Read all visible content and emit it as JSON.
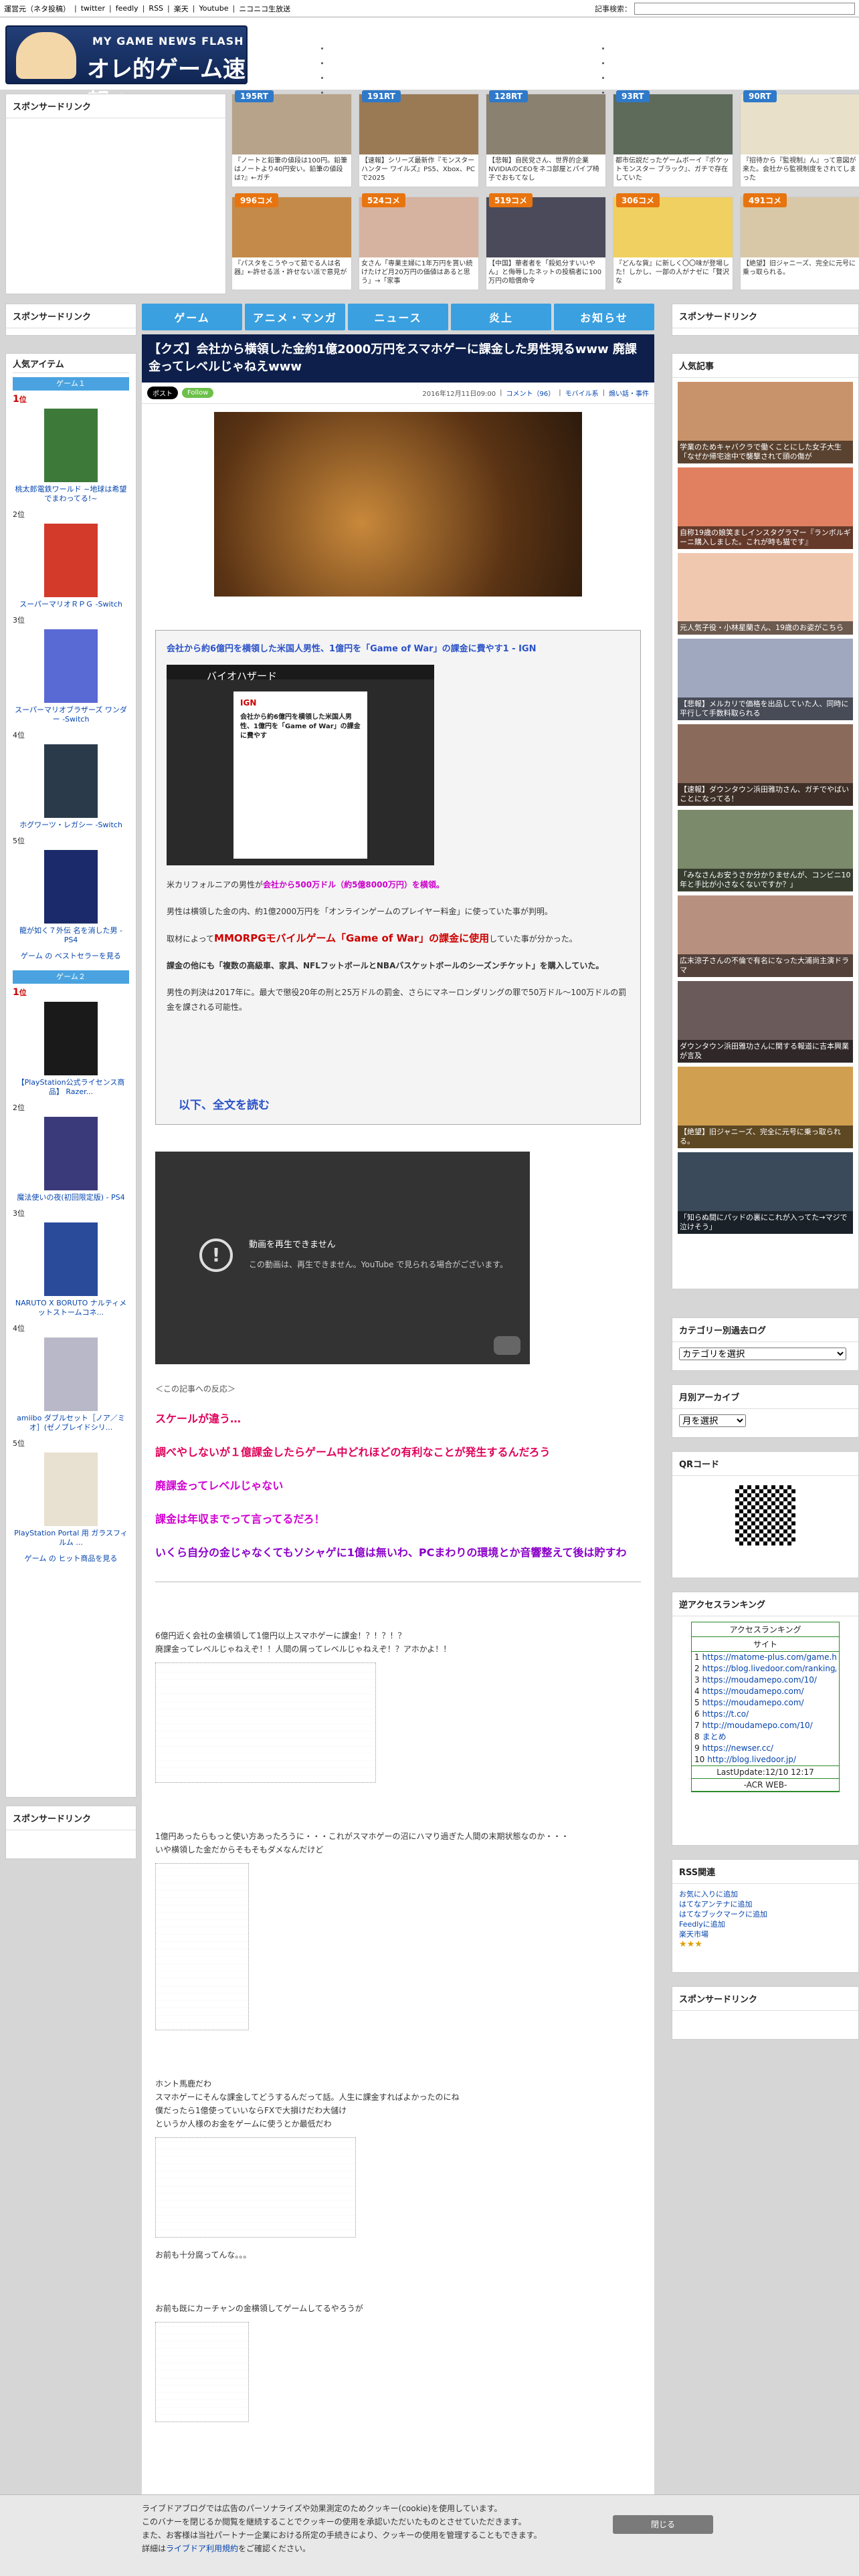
{
  "topbar": {
    "links": [
      "運営元（ネタ投稿）",
      "twitter",
      "feedly",
      "RSS",
      "楽天",
      "Youtube",
      "ニコニコ生放送"
    ],
    "search_label": "記事検索："
  },
  "logo": {
    "en": "MY GAME NEWS FLASH",
    "ja": "オレ的ゲーム速報@JIN"
  },
  "sponsored": "スポンサードリンク",
  "thumbs": [
    {
      "badge": "195RT",
      "color": "#2f79c9",
      "caption": "『ノートと鉛筆の値段は100円。鉛筆はノートより40円安い。鉛筆の値段は?』←ガチ"
    },
    {
      "badge": "191RT",
      "color": "#2f79c9",
      "caption": "【速報】シリーズ最新作『モンスターハンター ワイルズ』PS5、Xbox、PCで2025"
    },
    {
      "badge": "128RT",
      "color": "#2f79c9",
      "caption": "【悲報】自民党さん、世界的企業NVIDIAのCEOをネコ部屋とパイプ椅子でおもてなし"
    },
    {
      "badge": "93RT",
      "color": "#2f79c9",
      "caption": "都市伝説だったゲームボーイ『ポケットモンスター ブラック』、ガチで存在していた"
    },
    {
      "badge": "90RT",
      "color": "#2f79c9",
      "caption": "『招待から『監視制』ん』って意図が来た。会社から監視制度をされてしまった"
    },
    {
      "badge": "996コメ",
      "color": "#e8740f",
      "caption": "『パスタをこうやって茹でる人は名器』←許せる派・許せない派で意見が"
    },
    {
      "badge": "524コメ",
      "color": "#e8740f",
      "caption": "女さん「専業主婦に1年万円を貰い続けたけど月20万円の価値はあると思う」→「家事"
    },
    {
      "badge": "519コメ",
      "color": "#e8740f",
      "caption": "【中国】華者者を「殺処分すいいやん」と侮辱したネットの投稿者に100万円の賠償命令"
    },
    {
      "badge": "306コメ",
      "color": "#e8740f",
      "caption": "『どんな貨』に新しく〇〇味が登場した！しかし、一部の人がナゼに「贅沢な"
    },
    {
      "badge": "491コメ",
      "color": "#e8740f",
      "caption": "【絶望】旧ジャニーズ、完全に元号に乗っ取られる。"
    }
  ],
  "nav": [
    "ゲーム",
    "アニメ・マンガ",
    "ニュース",
    "炎上",
    "お知らせ"
  ],
  "article": {
    "title": "【クズ】会社から横領した金約1億2000万円をスマホゲーに課金した男性現るwww 廃課金ってレベルじゃねえwww",
    "tweet": "ポスト",
    "follow": "Follow",
    "date": "2016年12月11日09:00",
    "comments": "コメント（96）",
    "category1": "モバイル系",
    "category2": "煽い話・事件"
  },
  "quote": {
    "heading": "会社から約6億円を横領した米国人男性、1億円を「Game of War」の課金に費やす1 - IGN",
    "p1_a": "米カリフォルニアの男性が",
    "p1_b": "会社から500万ドル（約5億8000万円）を横領。",
    "p2": "男性は横領した金の内、約1億2000万円を「オンラインゲームのプレイヤー料金」に使っていた事が判明。",
    "p3_a": "取材によって",
    "p3_b": "MMORPGモバイルゲーム「Game of War」の課金に使用",
    "p3_c": "していた事が分かった。",
    "p4": "課金の他にも「複数の高級車、家具、NFLフットボールとNBAバスケットボールのシーズンチケット」を購入していた。",
    "p5": "男性の判決は2017年に。最大で懲役20年の刑と25万ドルの罰金、さらにマネーロンダリングの罪で50万ドル〜100万ドルの罰金を課される可能性。",
    "more": "以下、全文を読む",
    "article_title_img": "会社から約6億円を横領した米国人男性、1億円を「Game of War」の課金に費やす",
    "bio": "バイオハザード"
  },
  "video": {
    "title": "動画を再生できません",
    "msg": "この動画は、再生できません。YouTube で見られる場合がございます。"
  },
  "reactions": {
    "header": "＜この記事への反応＞",
    "items": [
      {
        "text": "スケールが違う…",
        "color": "#e0005a"
      },
      {
        "text": "調べやしないが１億課金したらゲーム中どれほどの有利なことが発生するんだろう",
        "color": "#e0005a"
      },
      {
        "text": "廃課金ってレベルじゃない",
        "color": "#d000d0"
      },
      {
        "text": "課金は年収までって言ってるだろ！",
        "color": "#d000d0"
      },
      {
        "text": "いくら自分の金じゃなくてもソシャゲに1億は無いわ、PCまわりの環境とか音響整えて後は貯すわ",
        "color": "#8a00c8"
      }
    ]
  },
  "aa": [
    {
      "l1": "6億円近く会社の金横領して1億円以上スマホゲーに課金！？！？！？",
      "l2": "廃課金ってレベルじゃねえぞ！！人間の屑ってレベルじゃねえぞ！？アホかよ！！"
    },
    {
      "l1": "1億円あったらもっと使い方あったろうに・・・これがスマホゲーの沼にハマり過ぎた人間の末期状態なのか・・・",
      "l2": "いや横領した金だからそもそもダメなんだけど"
    },
    {
      "l1": "ホント馬鹿だわ",
      "l2": "スマホゲーにそんな課金してどうするんだって話。人生に課金すればよかったのにね",
      "l3": "僕だったら1億使っていいならFXで大損けだわ大儲け",
      "l4": "というか人様のお金をゲームに使うとか最低だわ",
      "l5": "お前も十分腐ってんな。。。"
    },
    {
      "l1": "お前も既にカーチャンの金横領してゲームしてるやろうが"
    }
  ],
  "left": {
    "popular_title": "人気アイテム",
    "game1_label": "ゲーム１",
    "game2_label": "ゲーム２",
    "rank_prefix": "位",
    "items1": [
      {
        "rank": "1",
        "name": "桃太郎電鉄ワールド ~地球は希望でまわってる!~"
      },
      {
        "rank": "2",
        "name": "スーパーマリオＲＰＧ -Switch"
      },
      {
        "rank": "3",
        "name": "スーパーマリオブラザーズ ワンダー -Switch"
      },
      {
        "rank": "4",
        "name": "ホグワーツ・レガシー -Switch"
      },
      {
        "rank": "5",
        "name": "龍が如く７外伝 名を消した男 - PS4"
      }
    ],
    "more1": "ゲーム の ベストセラーを見る",
    "items2": [
      {
        "rank": "1",
        "name": "【PlayStation公式ライセンス商品】 Razer..."
      },
      {
        "rank": "2",
        "name": "魔法使いの夜(初回限定版) - PS4"
      },
      {
        "rank": "3",
        "name": "NARUTO X BORUTO ナルティメットストームコネ..."
      },
      {
        "rank": "4",
        "name": "amiibo ダブルセット［ノア／ミオ］(ゼノブレイドシリ..."
      },
      {
        "rank": "5",
        "name": "PlayStation Portal 用 ガラスフィルム ..."
      }
    ],
    "more2": "ゲーム の ヒット商品を見る"
  },
  "right": {
    "popular_title": "人気記事",
    "popular": [
      "学業のためキャバクラで働くことにした女子大生「なぜか帰宅途中で襲撃されて頭の傷が",
      "自称19歳の娘笑ましインスタグラマー『ランボルギーニ購入しました。これが時も猫です』",
      "元人気子役・小林星蘭さん、19歳のお姿がこちら",
      "【悲報】メルカリで価格を出品していた人、同時に平行して手数料取られる",
      "【速報】ダウンタウン浜田雅功さん、ガチでやばいことになってる！",
      "「みなさんお安うさか分かりませんが、コンビニ10年と手比が小さなくないですか？」",
      "広末涼子さんの不倫で有名になった大浦尚主演ドラマ",
      "ダウンタウン浜田雅功さんに関する報道に吉本興業が言及",
      "【絶望】旧ジャニーズ、完全に元号に乗っ取られる。",
      "「知らぬ間にパッドの裏にこれが入ってた→マジで泣けそう」"
    ],
    "cat_title": "カテゴリー別過去ログ",
    "cat_select": "カテゴリを選択",
    "month_title": "月別アーカイブ",
    "month_select": "月を選択",
    "qr_title": "QRコード",
    "acr_title": "逆アクセスランキング",
    "acr_head": "アクセスランキング",
    "acr_col": "サイト",
    "acr_rows": [
      {
        "n": "1",
        "url": "https://matome-plus.com/game.html"
      },
      {
        "n": "2",
        "url": "https://blog.livedoor.com/ranking/"
      },
      {
        "n": "3",
        "url": "https://moudamepo.com/10/"
      },
      {
        "n": "4",
        "url": "https://moudamepo.com/"
      },
      {
        "n": "5",
        "url": "https://moudamepo.com/"
      },
      {
        "n": "6",
        "url": "https://t.co/"
      },
      {
        "n": "7",
        "url": "http://moudamepo.com/10/"
      },
      {
        "n": "8",
        "url": "まとめ"
      },
      {
        "n": "9",
        "url": "https://newser.cc/"
      },
      {
        "n": "10",
        "url": "http://blog.livedoor.jp/"
      }
    ],
    "acr_update": "LastUpdate:12/10 12:17",
    "acr_foot": "-ACR WEB-",
    "rss_title": "RSS関連",
    "rss_links": [
      "お気に入りに追加",
      "はてなアンテナに追加",
      "はてなブックマークに追加",
      "Feedlyに追加",
      "楽天市場"
    ]
  },
  "cookie": {
    "l1": "ライブドアブログでは広告のパーソナライズや効果測定のためクッキー(cookie)を使用しています。",
    "l2": "このバナーを閉じるか閲覧を継続することでクッキーの使用を承認いただいたものとさせていただきます。",
    "l3": "また、お客様は当社パートナー企業における所定の手続きにより、クッキーの使用を管理することもできます。",
    "l4a": "詳細は",
    "l4b": "ライブドア利用規約",
    "l4c": "をご確認ください。",
    "close": "閉じる"
  }
}
